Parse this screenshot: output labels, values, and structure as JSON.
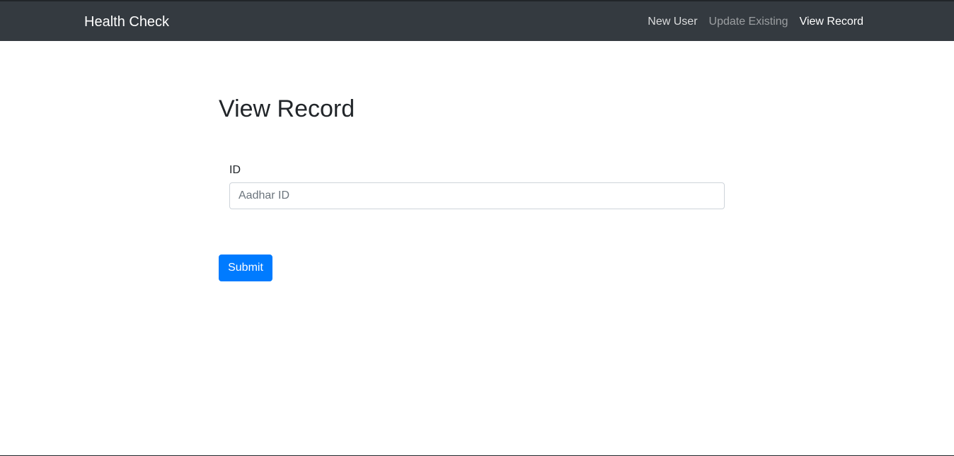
{
  "navbar": {
    "brand": "Health Check",
    "links": [
      {
        "label": "New User"
      },
      {
        "label": "Update Existing"
      },
      {
        "label": "View Record"
      }
    ]
  },
  "form": {
    "title": "View Record",
    "id_label": "ID",
    "id_value": "",
    "id_placeholder": "Aadhar ID",
    "submit_label": "Submit"
  },
  "colors": {
    "navbar_bg": "#343a40",
    "primary": "#007bff",
    "text": "#212529"
  }
}
